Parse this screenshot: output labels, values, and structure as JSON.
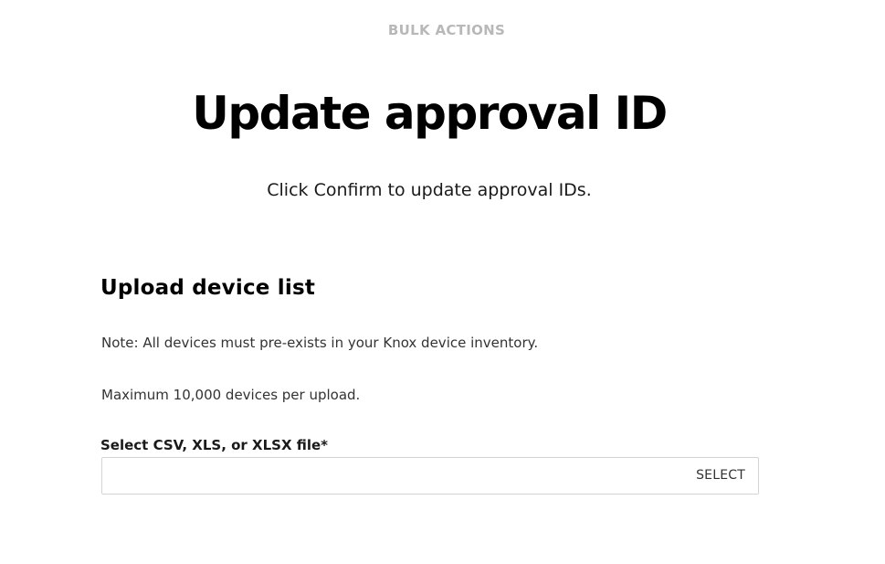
{
  "header": {
    "eyebrow": "BULK ACTIONS",
    "title": "Update approval ID",
    "subtitle": "Click Confirm to update approval IDs."
  },
  "upload": {
    "section_title": "Upload device list",
    "note": "Note: All devices must pre-exists in your Knox device inventory.",
    "max_text": "Maximum 10,000 devices per upload.",
    "field_label": "Select CSV, XLS, or XLSX file*",
    "file_value": "",
    "select_label": "SELECT"
  }
}
